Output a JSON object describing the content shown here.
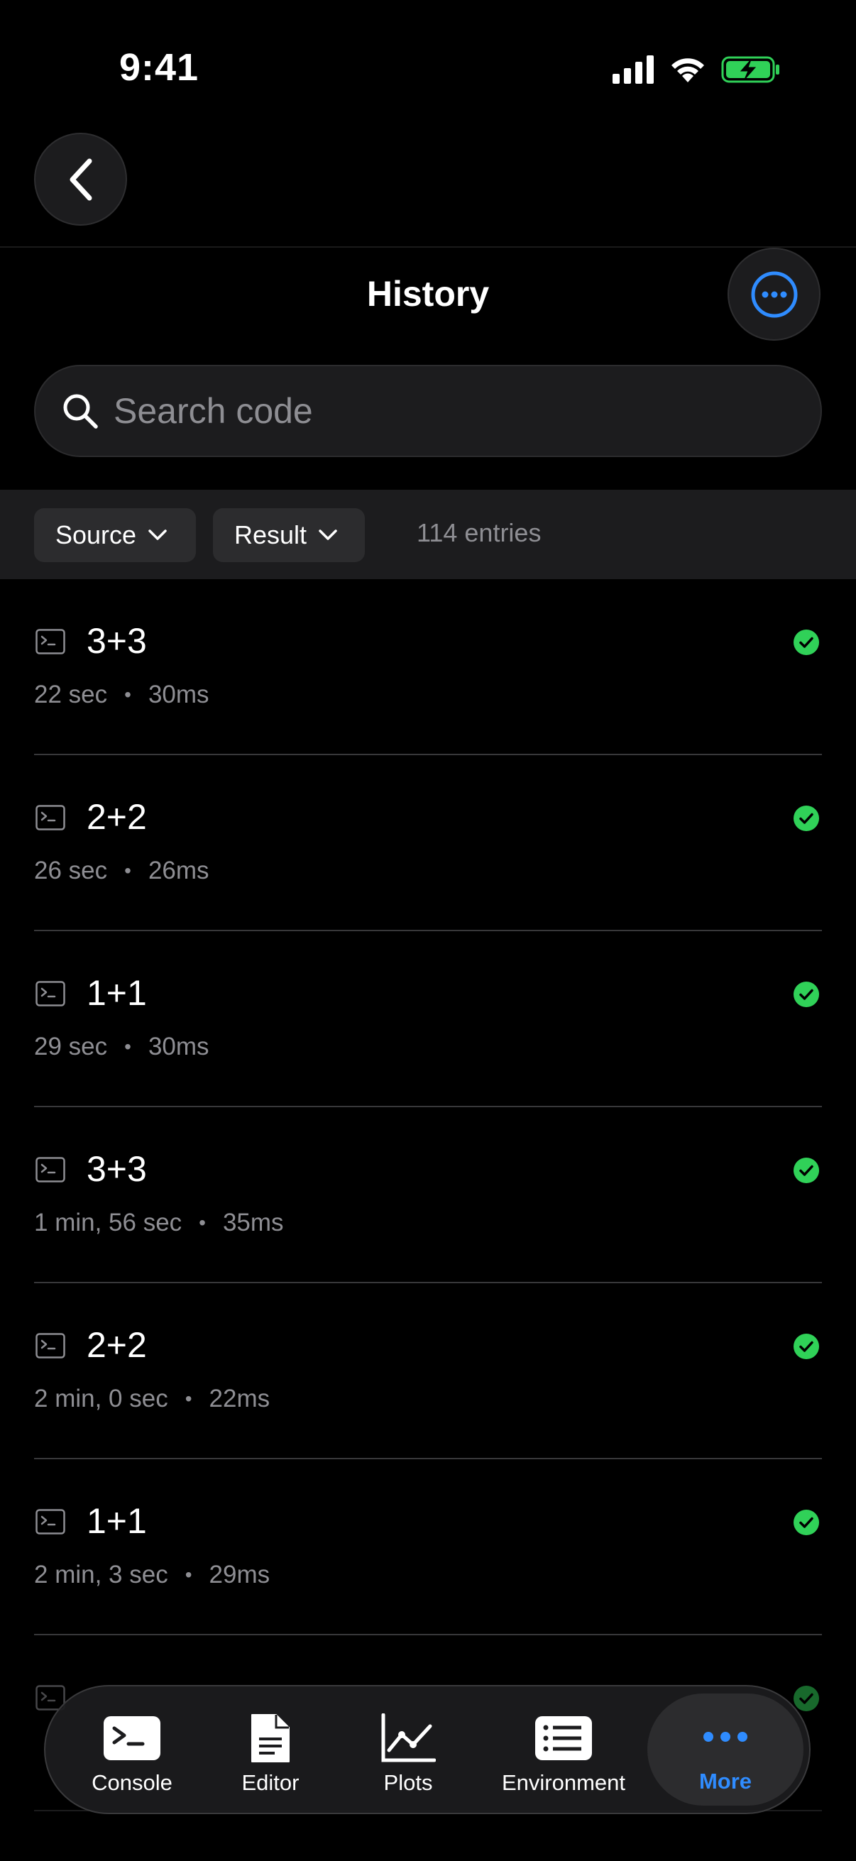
{
  "status_bar": {
    "time": "9:41"
  },
  "header": {
    "title": "History"
  },
  "search": {
    "placeholder": "Search code",
    "value": ""
  },
  "filters": {
    "source_label": "Source",
    "result_label": "Result",
    "entry_count": "114 entries"
  },
  "history": [
    {
      "code": "3+3",
      "ago": "22 sec",
      "duration": "30ms",
      "status": "success"
    },
    {
      "code": "2+2",
      "ago": "26 sec",
      "duration": "26ms",
      "status": "success"
    },
    {
      "code": "1+1",
      "ago": "29 sec",
      "duration": "30ms",
      "status": "success"
    },
    {
      "code": "3+3",
      "ago": "1 min, 56 sec",
      "duration": "35ms",
      "status": "success"
    },
    {
      "code": "2+2",
      "ago": "2 min, 0 sec",
      "duration": "22ms",
      "status": "success"
    },
    {
      "code": "1+1",
      "ago": "2 min, 3 sec",
      "duration": "29ms",
      "status": "success"
    }
  ],
  "tabs": [
    {
      "label": "Console",
      "icon": "terminal-icon"
    },
    {
      "label": "Editor",
      "icon": "document-icon"
    },
    {
      "label": "Plots",
      "icon": "line-chart-icon"
    },
    {
      "label": "Environment",
      "icon": "list-icon"
    },
    {
      "label": "More",
      "icon": "ellipsis-icon",
      "active": true
    }
  ],
  "colors": {
    "accent": "#2f8cff",
    "success": "#30d158",
    "background": "#000000",
    "surface": "#1c1c1e"
  }
}
